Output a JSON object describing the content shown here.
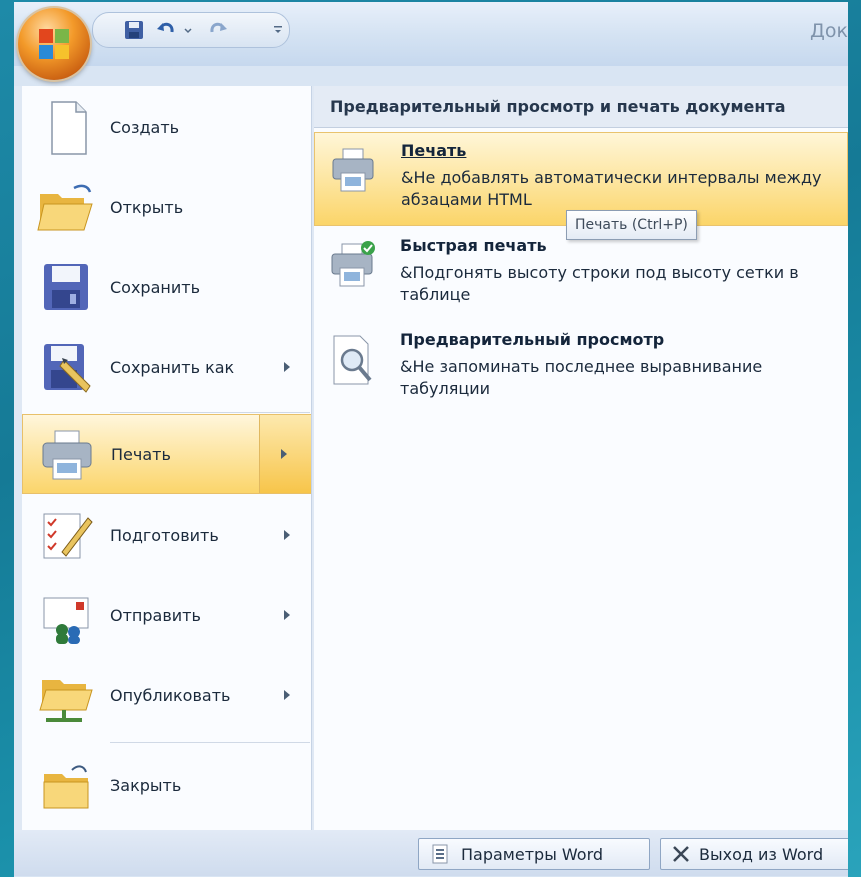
{
  "window": {
    "title_partial": "Док"
  },
  "qat": {
    "save_icon": "save-icon",
    "undo_icon": "undo-icon",
    "redo_icon": "redo-icon",
    "customize_icon": "customize-icon"
  },
  "menu": {
    "left_items": [
      {
        "label": "Создать",
        "icon": "new-document-icon",
        "has_submenu": false
      },
      {
        "label": "Открыть",
        "icon": "open-folder-icon",
        "has_submenu": false
      },
      {
        "label": "Сохранить",
        "icon": "save-icon",
        "has_submenu": false
      },
      {
        "label": "Сохранить как",
        "icon": "save-as-icon",
        "has_submenu": true
      },
      {
        "label": "Печать",
        "icon": "printer-icon",
        "has_submenu": true,
        "active": true
      },
      {
        "label": "Подготовить",
        "icon": "prepare-icon",
        "has_submenu": true
      },
      {
        "label": "Отправить",
        "icon": "send-icon",
        "has_submenu": true
      },
      {
        "label": "Опубликовать",
        "icon": "publish-icon",
        "has_submenu": true
      },
      {
        "label": "Закрыть",
        "icon": "close-folder-icon",
        "has_submenu": false
      }
    ],
    "right_header": "Предварительный просмотр и печать документа",
    "right_items": [
      {
        "title": "Печать",
        "desc": "&Не добавлять автоматически интервалы между абзацами HTML",
        "icon": "printer-icon",
        "highlighted": true
      },
      {
        "title": "Быстрая печать",
        "desc": "&Подгонять высоту строки под высоту сетки в таблице",
        "icon": "quick-print-icon",
        "highlighted": false
      },
      {
        "title": "Предварительный просмотр",
        "desc": "&Не запоминать последнее выравнивание табуляции",
        "icon": "print-preview-icon",
        "highlighted": false
      }
    ],
    "tooltip": "Печать (Ctrl+P)"
  },
  "bottom": {
    "options_label": "Параметры Word",
    "exit_label": "Выход из Word"
  },
  "colors": {
    "accent_orange": "#f39a2a",
    "highlight": "#fbd56b",
    "background": "#157a96"
  }
}
